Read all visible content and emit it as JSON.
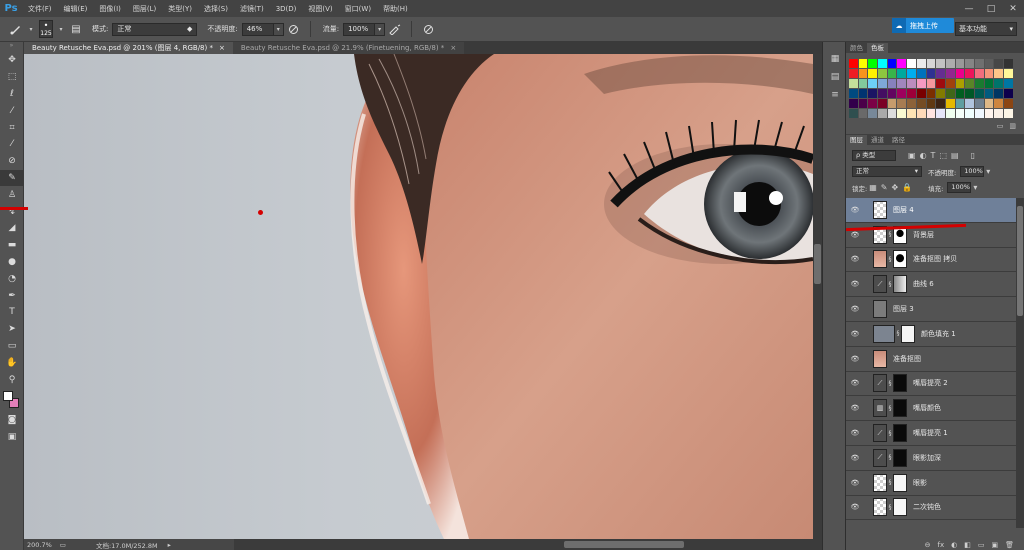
{
  "app": {
    "logo": "Ps"
  },
  "menu": [
    "文件(F)",
    "编辑(E)",
    "图像(I)",
    "图层(L)",
    "类型(Y)",
    "选择(S)",
    "滤镜(T)",
    "3D(D)",
    "视图(V)",
    "窗口(W)",
    "帮助(H)"
  ],
  "window_controls": [
    "—",
    "□",
    "✕"
  ],
  "options": {
    "brush_size": "125",
    "mode_label": "模式:",
    "mode_value": "正常",
    "opacity_label": "不透明度:",
    "opacity_value": "46%",
    "flow_label": "流量:",
    "flow_value": "100%"
  },
  "upload_button": "拖拽上传",
  "workspace": "基本功能",
  "tabs": [
    {
      "label": "Beauty Retusche Eva.psd @ 201% (图层 4, RGB/8) *",
      "active": true
    },
    {
      "label": "Beauty Retusche Eva.psd @ 21.9% (Finetuening, RGB/8) *",
      "active": false
    }
  ],
  "status": {
    "zoom": "200.7%",
    "doc": "文档:17.0M/252.8M"
  },
  "panel_tabs_top": [
    "颜色",
    "色板"
  ],
  "panel_tabs_layers": [
    "图层",
    "通道",
    "路径"
  ],
  "layers_panel": {
    "filter_label": "ρ 类型",
    "blend_mode": "正常",
    "opacity_label": "不透明度:",
    "opacity_value": "100%",
    "lock_label": "锁定:",
    "fill_label": "填充:",
    "fill_value": "100%"
  },
  "layers": [
    {
      "name": "图层 4",
      "thumb": "trans",
      "mask": "",
      "selected": true
    },
    {
      "name": "背景层",
      "thumb": "trans",
      "mask": "mask1",
      "selected": false
    },
    {
      "name": "准备抠图 拷贝",
      "thumb": "face",
      "mask": "mask2",
      "selected": false
    },
    {
      "name": "曲线 6",
      "thumb": "adj",
      "mask": "curve",
      "selected": false
    },
    {
      "name": "图层 3",
      "thumb": "gray",
      "mask": "",
      "selected": false
    },
    {
      "name": "颜色填充 1",
      "thumb": "fill",
      "mask": "white",
      "selected": false
    },
    {
      "name": "准备抠图",
      "thumb": "face",
      "mask": "",
      "selected": false
    },
    {
      "name": "嘴唇提亮 2",
      "thumb": "adj",
      "mask": "black",
      "selected": false
    },
    {
      "name": "嘴唇颜色",
      "thumb": "adj",
      "mask": "black",
      "selected": false
    },
    {
      "name": "嘴唇提亮 1",
      "thumb": "adj",
      "mask": "black",
      "selected": false
    },
    {
      "name": "眼影加深",
      "thumb": "adj",
      "mask": "black",
      "selected": false
    },
    {
      "name": "眼影",
      "thumb": "trans",
      "mask": "white",
      "selected": false
    },
    {
      "name": "二次钝色",
      "thumb": "trans",
      "mask": "white",
      "selected": false
    }
  ],
  "layers_footer": [
    "⊖",
    "fx",
    "◐",
    "◧",
    "▭",
    "▣",
    "🗑"
  ],
  "colors": {
    "accent": "#1f8ad9",
    "selected_layer": "#6f8099",
    "annotation_red": "#d40000"
  }
}
